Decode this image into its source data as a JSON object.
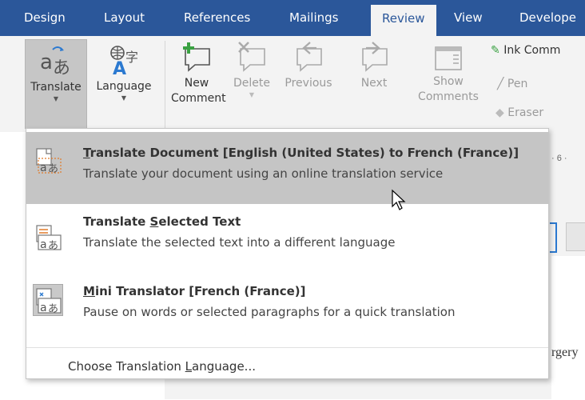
{
  "tabs": {
    "design": "Design",
    "layout": "Layout",
    "references": "References",
    "mailings": "Mailings",
    "review": "Review",
    "view": "View",
    "developer": "Develope"
  },
  "ribbon": {
    "translate": "Translate",
    "language": "Language",
    "new_comment_1": "New",
    "new_comment_2": "Comment",
    "delete": "Delete",
    "previous": "Previous",
    "next": "Next",
    "show_comments_1": "Show",
    "show_comments_2": "Comments",
    "ink_comment": "Ink Comm",
    "pen": "Pen",
    "eraser": "Eraser"
  },
  "menu": {
    "items": [
      {
        "title_key": "T",
        "title_rest": "ranslate Document [English (United States) to French (France)]",
        "desc": "Translate your document using an online translation service"
      },
      {
        "title_pre": "Translate ",
        "title_key": "S",
        "title_rest": "elected Text",
        "desc": "Translate the selected text into a different language"
      },
      {
        "title_key": "M",
        "title_rest": "ini Translator [French (France)]",
        "desc": "Pause on words or selected paragraphs for a quick translation"
      }
    ],
    "footer_pre": "Choose Translation ",
    "footer_key": "L",
    "footer_rest": "anguage..."
  },
  "document": {
    "ruler_text": "· 6 ·",
    "visible_word": "rgery"
  },
  "colors": {
    "tab_bar": "#2b579a",
    "ribbon_bg": "#f3f3f3",
    "menu_highlight": "#c5c5c5",
    "new_comment_plus": "#3aa142"
  }
}
